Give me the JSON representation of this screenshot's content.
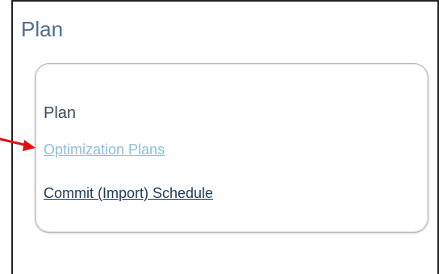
{
  "page": {
    "title": "Plan"
  },
  "card": {
    "heading": "Plan",
    "links": [
      {
        "label": "Optimization Plans",
        "state": "highlighted"
      },
      {
        "label": "Commit (Import) Schedule",
        "state": "normal"
      }
    ]
  },
  "annotation": {
    "arrow_color": "#e01010",
    "points_to": "Optimization Plans"
  },
  "colors": {
    "title": "#4e6f8f",
    "heading": "#3b4a5e",
    "link_highlighted": "#8fbde0",
    "link_normal": "#1f3a5c",
    "frame_border": "#222222",
    "card_border": "#b7b7b7"
  }
}
